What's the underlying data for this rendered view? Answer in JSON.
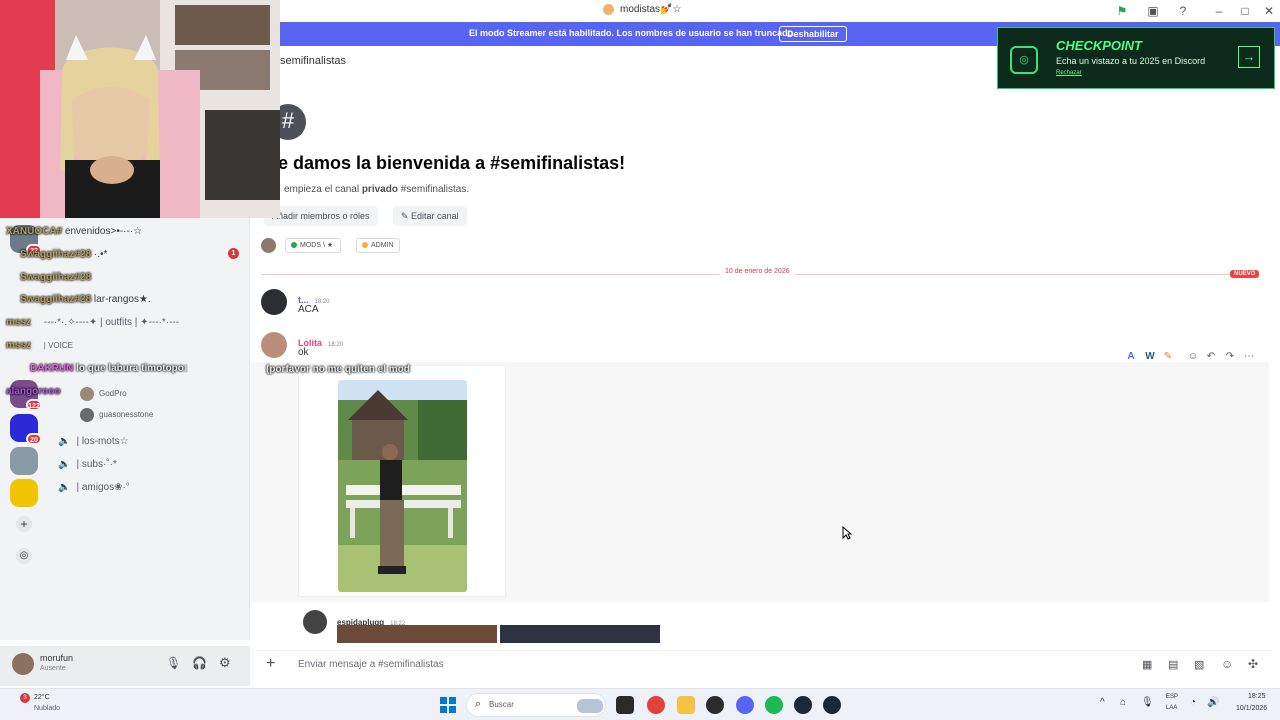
{
  "window": {
    "title": "modistas💅☆"
  },
  "streamer_banner": {
    "message": "El modo Streamer está habilitado. Los nombres de usuario se han truncado.",
    "button": "Deshabilitar"
  },
  "promo": {
    "title": "CHECKPOINT",
    "subtitle": "Echa un vistazo a tu 2025 en Discord",
    "dismiss": "Rechazar"
  },
  "channel": {
    "name": "semifinalistas",
    "welcome_title": "e damos la bienvenida a #semifinalistas!",
    "welcome_prefix": "empieza el canal",
    "welcome_bold": "privado",
    "welcome_suffix": "#semifinalistas.",
    "add_members": "Añadir miembros o roles",
    "edit_channel": "Editar canal",
    "roles": [
      {
        "label": "MODS \\ ★·",
        "color": "#23a55a"
      },
      {
        "label": "ADMIN",
        "color": "#f0b232"
      }
    ]
  },
  "divider": {
    "date": "10 de enero de 2026",
    "new_label": "NUEVO"
  },
  "messages": [
    {
      "user": "t...",
      "time": "18:20",
      "text": "ACA",
      "color": "#5865f2"
    },
    {
      "user": "Lolita",
      "time": "18:20",
      "text": "ok",
      "color": "#e8437a"
    },
    {
      "user": "espidaplugg",
      "time": "18:22",
      "text": "",
      "color": "#313338"
    }
  ],
  "overlay_chat": [
    {
      "user": "XANUOCA#",
      "text": "envenidos>•-·-·☆"
    },
    {
      "user": "Swaggiihaz#28",
      "text": "·.•*"
    },
    {
      "user": "Swaggiihaz#28",
      "text": ""
    },
    {
      "user": "Swaggiihaz#28",
      "text": "lar-rangos★."
    },
    {
      "user": "mssz",
      "text": "---·*·.✧----✦ | outfits | ✦---·*·---"
    },
    {
      "user": "mssz",
      "text": "| VOICE"
    },
    {
      "user": "DAKRUN",
      "text": "lo que labura timotopo:"
    },
    {
      "user": "alangorooo",
      "text": "(porfavor no me quiten el mod"
    }
  ],
  "sidebar": {
    "voice_users": [
      "GodPro",
      "guasonesstone"
    ],
    "channels": [
      "| los-mots☆",
      "| subs·˚·*",
      "| amigos❀·°"
    ],
    "badges": [
      "22",
      "122",
      "20"
    ],
    "unread": "1"
  },
  "composer": {
    "placeholder": "Enviar mensaje a #semifinalistas"
  },
  "user": {
    "name": "morufun",
    "status": "Ausente"
  },
  "taskbar": {
    "weather_temp": "22°C",
    "weather_desc": "Nublado",
    "search_placeholder": "Buscar",
    "lang_top": "ESP",
    "lang_bottom": "LAA",
    "time": "18:25",
    "date": "10/1/2026",
    "weather_badge": "3"
  }
}
